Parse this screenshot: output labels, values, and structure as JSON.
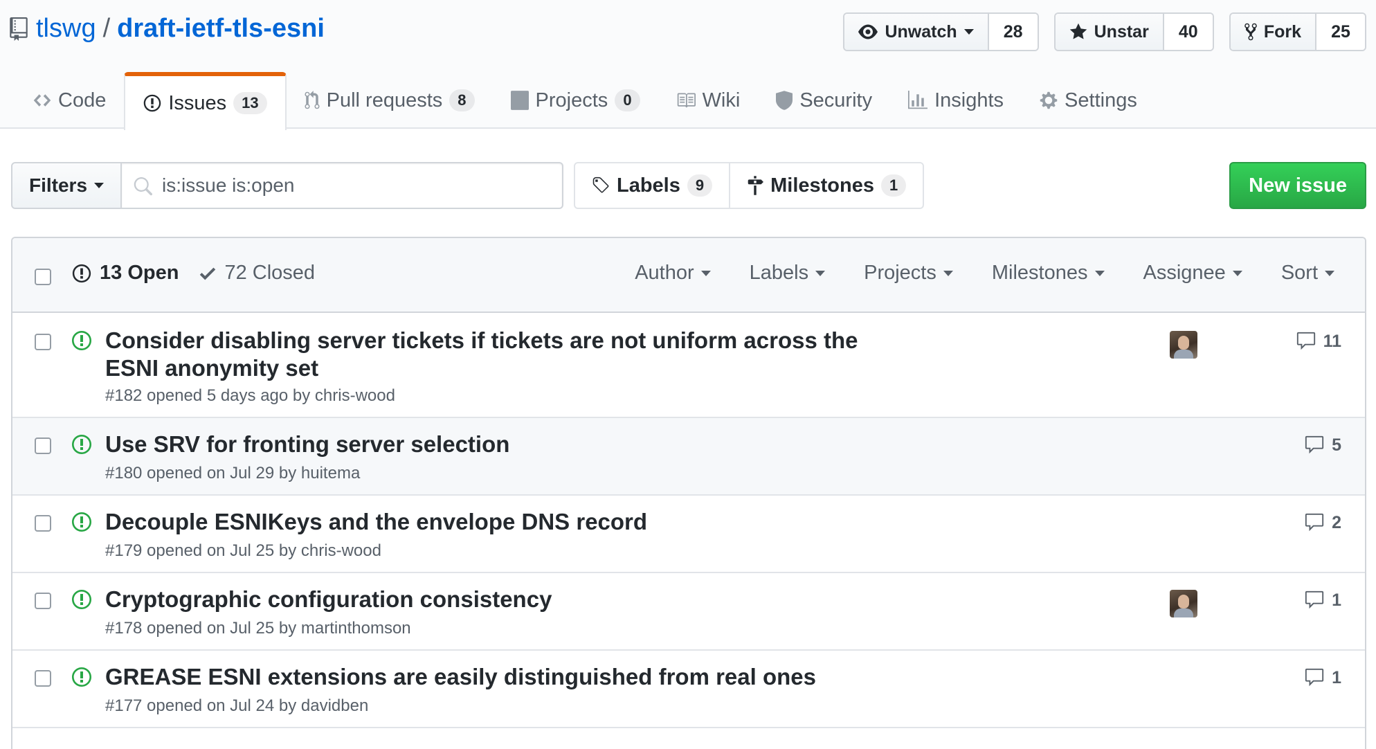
{
  "repo": {
    "owner": "tlswg",
    "separator": "/",
    "name": "draft-ietf-tls-esni"
  },
  "social": {
    "watch": {
      "label": "Unwatch",
      "count": "28"
    },
    "star": {
      "label": "Unstar",
      "count": "40"
    },
    "fork": {
      "label": "Fork",
      "count": "25"
    }
  },
  "tabs": [
    {
      "label": "Code",
      "icon": "code-icon"
    },
    {
      "label": "Issues",
      "icon": "issue-opened-icon",
      "counter": "13",
      "selected": true
    },
    {
      "label": "Pull requests",
      "icon": "git-pull-request-icon",
      "counter": "8"
    },
    {
      "label": "Projects",
      "icon": "project-icon",
      "counter": "0"
    },
    {
      "label": "Wiki",
      "icon": "book-icon"
    },
    {
      "label": "Security",
      "icon": "shield-icon"
    },
    {
      "label": "Insights",
      "icon": "graph-icon"
    },
    {
      "label": "Settings",
      "icon": "gear-icon"
    }
  ],
  "subnav": {
    "filters_label": "Filters",
    "search_value": "is:issue is:open",
    "labels_label": "Labels",
    "labels_count": "9",
    "milestones_label": "Milestones",
    "milestones_count": "1",
    "new_issue_label": "New issue"
  },
  "table_header": {
    "open_label": "13 Open",
    "closed_label": "72 Closed",
    "sorts": [
      "Author",
      "Labels",
      "Projects",
      "Milestones",
      "Assignee",
      "Sort"
    ]
  },
  "issues": [
    {
      "title": "Consider disabling server tickets if tickets are not uniform across the ESNI anonymity set",
      "meta": "#182 opened 5 days ago by chris-wood",
      "comments": "11",
      "has_assignee": true
    },
    {
      "title": "Use SRV for fronting server selection",
      "meta": "#180 opened on Jul 29 by huitema",
      "comments": "5",
      "has_assignee": false
    },
    {
      "title": "Decouple ESNIKeys and the envelope DNS record",
      "meta": "#179 opened on Jul 25 by chris-wood",
      "comments": "2",
      "has_assignee": false
    },
    {
      "title": "Cryptographic configuration consistency",
      "meta": "#178 opened on Jul 25 by martinthomson",
      "comments": "1",
      "has_assignee": true
    },
    {
      "title": "GREASE ESNI extensions are easily distinguished from real ones",
      "meta": "#177 opened on Jul 24 by davidben",
      "comments": "1",
      "has_assignee": false
    }
  ],
  "colors": {
    "link": "#0366d6",
    "accent_tab": "#e36209",
    "open_green": "#28a745",
    "new_issue_green": "#2ea44f"
  }
}
